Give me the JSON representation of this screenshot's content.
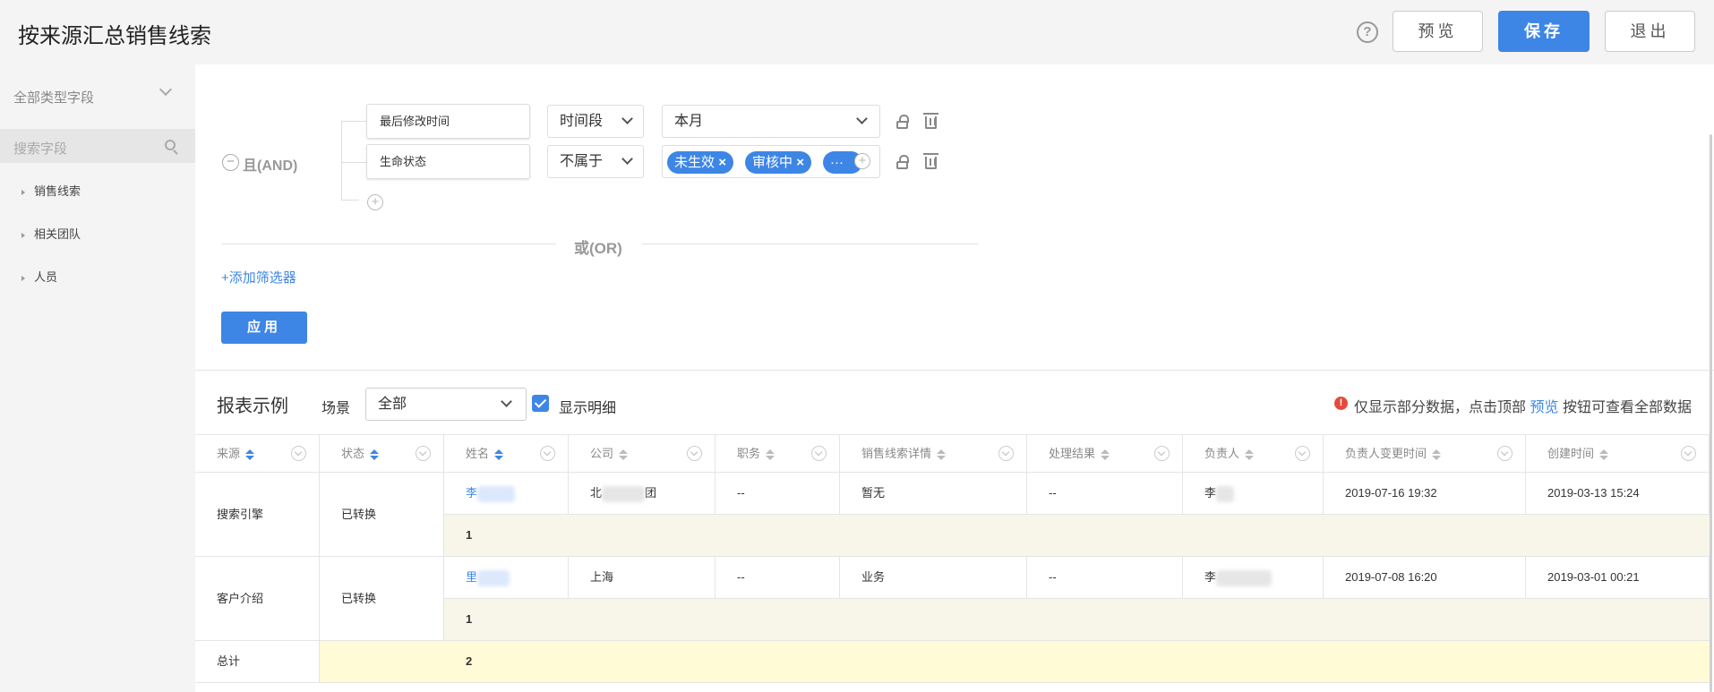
{
  "header": {
    "title": "按来源汇总销售线索",
    "help_icon": "?",
    "preview_label": "预览",
    "save_label": "保存",
    "exit_label": "退出"
  },
  "sidebar": {
    "type_filter_label": "全部类型字段",
    "search_placeholder": "搜索字段",
    "items": [
      {
        "label": "销售线索"
      },
      {
        "label": "相关团队"
      },
      {
        "label": "人员"
      }
    ]
  },
  "filters": {
    "logic_label": "且(AND)",
    "rows": [
      {
        "field": "最后修改时间",
        "operator": "时间段",
        "value": "本月"
      },
      {
        "field": "生命状态",
        "operator": "不属于",
        "tags": [
          "未生效",
          "审核中",
          "···"
        ]
      }
    ],
    "or_label": "或(OR)",
    "add_filter_label": "+添加筛选器",
    "apply_label": "应用"
  },
  "report": {
    "title": "报表示例",
    "scene_label": "场景",
    "scene_value": "全部",
    "show_detail_label": "显示明细",
    "notice_icon": "!",
    "notice_prefix": "仅显示部分数据，点击顶部",
    "notice_link": "预览",
    "notice_suffix": "按钮可查看全部数据"
  },
  "table": {
    "columns": [
      "来源",
      "状态",
      "姓名",
      "公司",
      "职务",
      "销售线索详情",
      "处理结果",
      "负责人",
      "负责人变更时间",
      "创建时间"
    ],
    "groups": [
      {
        "source": "搜索引擎",
        "status": "已转换",
        "name": "李",
        "company_prefix": "北",
        "company_suffix": "团",
        "title": "--",
        "detail": "暂无",
        "result": "--",
        "owner": "李",
        "owner_changed": "2019-07-16 19:32",
        "created": "2019-03-13 15:24",
        "subtotal": "1"
      },
      {
        "source": "客户介绍",
        "status": "已转换",
        "name": "里",
        "company": "上海",
        "title": "--",
        "detail": "业务",
        "result": "--",
        "owner": "李",
        "owner_changed": "2019-07-08 16:20",
        "created": "2019-03-01 00:21",
        "subtotal": "1"
      }
    ],
    "total_label": "总计",
    "total_value": "2"
  },
  "icons": {
    "collapse": "minus-circle-icon",
    "add": "plus-circle-icon",
    "lock": "lock-icon",
    "delete": "trash-icon",
    "remove_tag": "close-icon",
    "sort": "sort-icon",
    "column_menu": "chevron-down-icon",
    "checkbox": "checkbox-checked-icon",
    "notice": "exclamation-icon"
  },
  "colors": {
    "accent": "#3d86e6",
    "warning": "#e64a3c",
    "subtotal_bg": "#f8f6e8",
    "total_bg": "#fffbd6"
  }
}
